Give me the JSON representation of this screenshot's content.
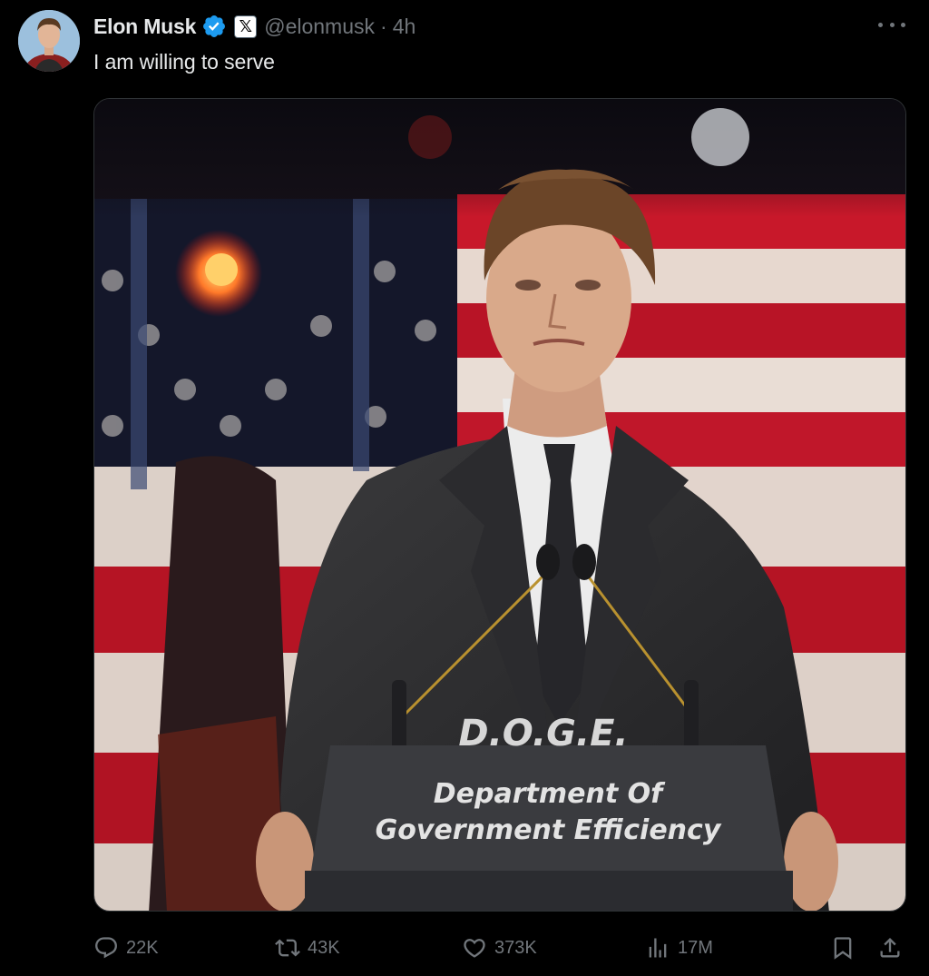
{
  "author": {
    "display_name": "Elon Musk",
    "handle": "@elonmusk",
    "time": "4h",
    "separator": "·",
    "verified_color": "#1d9bf0",
    "affiliation_icon": "x-logo-icon"
  },
  "tweet": {
    "text": "I am willing to serve"
  },
  "media": {
    "podium": {
      "acronym": "D.O.G.E.",
      "line1": "Department Of",
      "line2": "Government Efficiency"
    }
  },
  "actions": {
    "replies": "22K",
    "reposts": "43K",
    "likes": "373K",
    "views": "17M"
  },
  "colors": {
    "background": "#000000",
    "text_primary": "#e7e9ea",
    "text_secondary": "#71767b"
  }
}
